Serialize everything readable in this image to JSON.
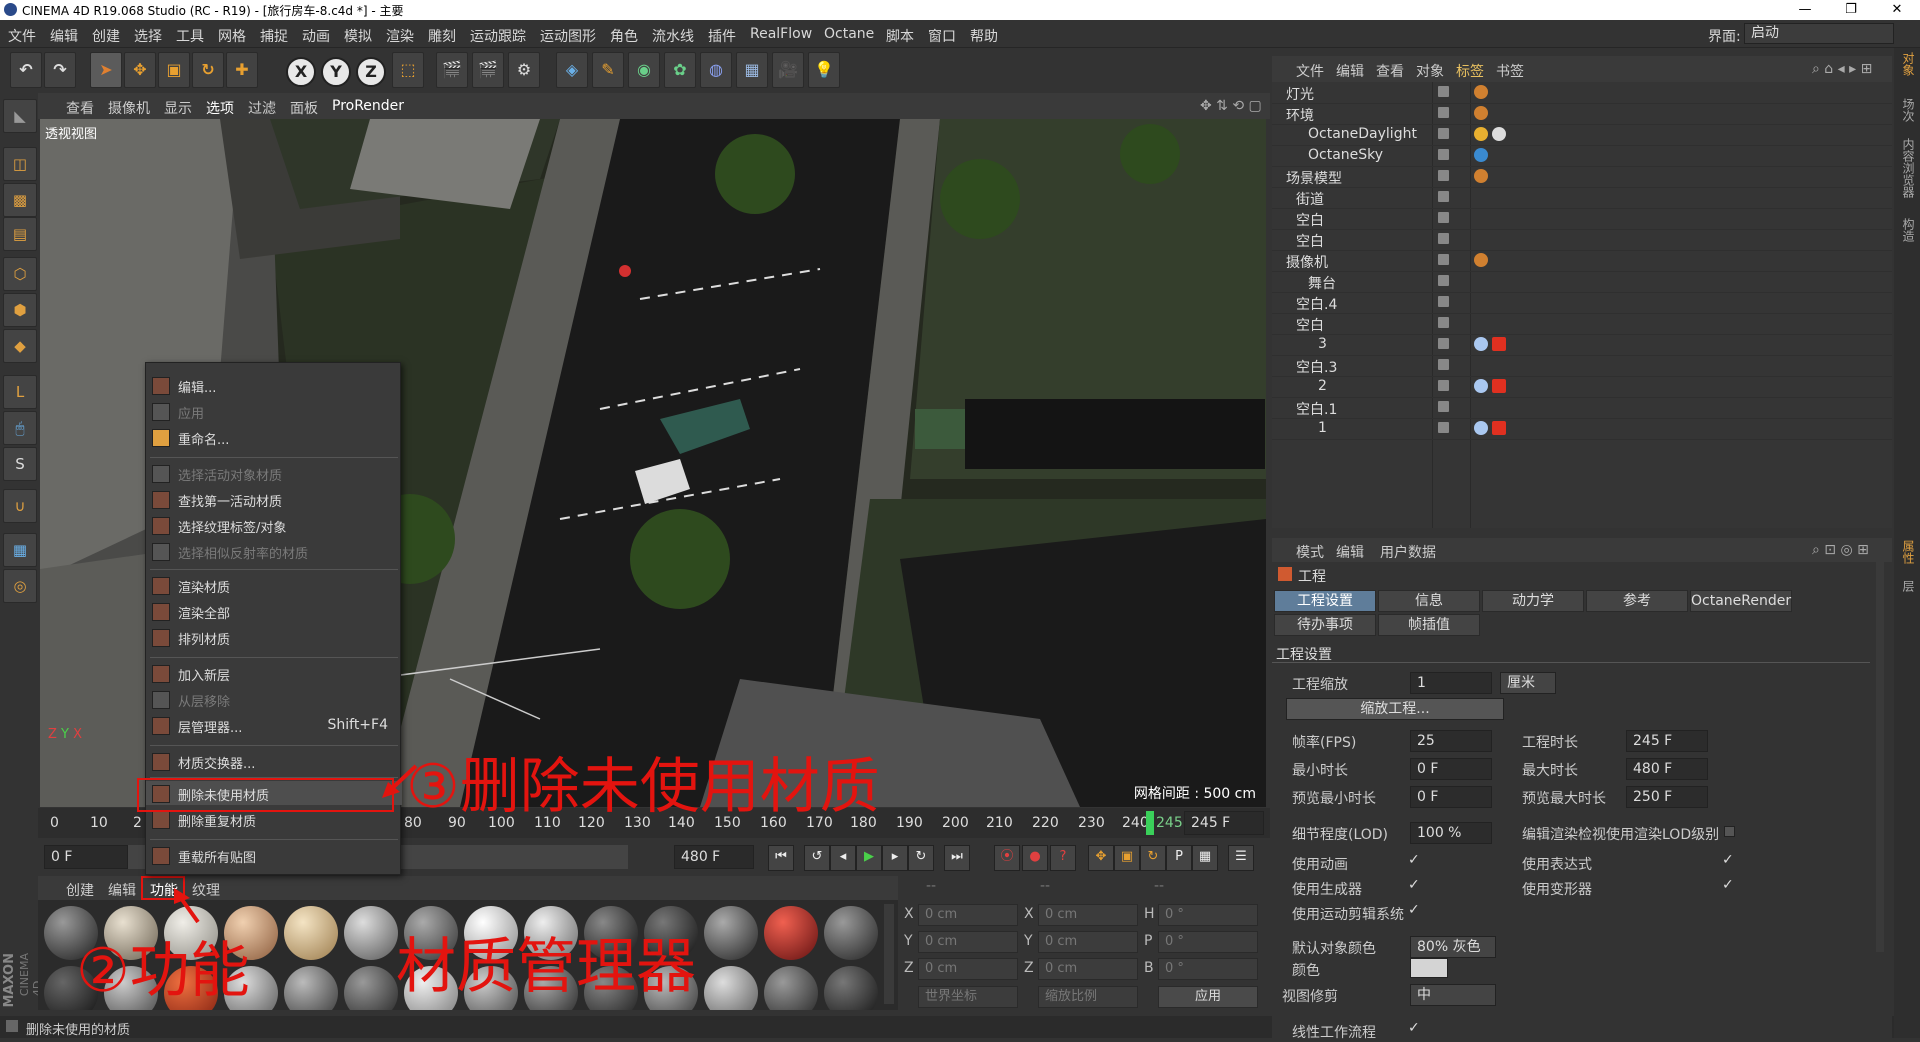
{
  "window": {
    "title": "CINEMA 4D R19.068 Studio (RC - R19) - [旅行房车-8.c4d *] - 主要"
  },
  "menu": [
    "文件",
    "编辑",
    "创建",
    "选择",
    "工具",
    "网格",
    "捕捉",
    "动画",
    "模拟",
    "渲染",
    "雕刻",
    "运动跟踪",
    "运动图形",
    "角色",
    "流水线",
    "插件",
    "RealFlow",
    "Octane",
    "脚本",
    "窗口",
    "帮助"
  ],
  "layout": {
    "label": "界面:",
    "value": "启动"
  },
  "toolbar": {
    "x": "X",
    "y": "Y",
    "z": "Z"
  },
  "viewport": {
    "menu": [
      "查看",
      "摄像机",
      "显示",
      "选项",
      "过滤",
      "面板",
      "ProRender"
    ],
    "name": "透视视图",
    "grid_info": "网格间距 : 500 cm"
  },
  "timeline": {
    "ticks": [
      "0",
      "10",
      "2",
      "80",
      "90",
      "100",
      "110",
      "120",
      "130",
      "140",
      "150",
      "160",
      "170",
      "180",
      "190",
      "200",
      "210",
      "220",
      "230",
      "240",
      "245"
    ],
    "current": "245 F",
    "start": "0 F",
    "end": "480 F"
  },
  "material_manager": {
    "menu": [
      "创建",
      "编辑",
      "功能",
      "纹理"
    ],
    "active_menu": "功能"
  },
  "coords": {
    "rows": [
      {
        "a": "X",
        "av": "0 cm",
        "b": "X",
        "bv": "0 cm",
        "c": "H",
        "cv": "0 °"
      },
      {
        "a": "Y",
        "av": "0 cm",
        "b": "Y",
        "bv": "0 cm",
        "c": "P",
        "cv": "0 °"
      },
      {
        "a": "Z",
        "av": "0 cm",
        "b": "Z",
        "bv": "0 cm",
        "c": "B",
        "cv": "0 °"
      }
    ],
    "world": "世界坐标",
    "scale": "缩放比例",
    "apply": "应用",
    "dashes": [
      "--",
      "--",
      "--"
    ]
  },
  "context_menu": {
    "items": [
      {
        "label": "编辑...",
        "disabled": false
      },
      {
        "label": "应用",
        "disabled": true
      },
      {
        "label": "重命名...",
        "disabled": false
      },
      {
        "label": "选择活动对象材质",
        "disabled": true
      },
      {
        "label": "查找第一活动材质",
        "disabled": false
      },
      {
        "label": "选择纹理标签/对象",
        "disabled": false
      },
      {
        "label": "选择相似反射率的材质",
        "disabled": true
      },
      {
        "label": "渲染材质",
        "disabled": false
      },
      {
        "label": "渲染全部",
        "disabled": false
      },
      {
        "label": "排列材质",
        "disabled": false
      },
      {
        "label": "加入新层",
        "disabled": false
      },
      {
        "label": "从层移除",
        "disabled": true
      },
      {
        "label": "层管理器...",
        "disabled": false,
        "shortcut": "Shift+F4"
      },
      {
        "label": "材质交换器...",
        "disabled": false
      },
      {
        "label": "删除未使用材质",
        "disabled": false,
        "highlight": true
      },
      {
        "label": "删除重复材质",
        "disabled": false
      },
      {
        "label": "重载所有贴图",
        "disabled": false
      }
    ]
  },
  "annotations": {
    "step3": "③删除未使用材质",
    "step2": "②功能",
    "manager": "材质管理器"
  },
  "status": "删除未使用的材质",
  "brand": {
    "maxon": "MAXON",
    "c4d": "CINEMA 4D"
  },
  "object_manager": {
    "menu": [
      "文件",
      "编辑",
      "查看",
      "对象",
      "标签",
      "书签"
    ],
    "active_menu": "标签",
    "objects": [
      {
        "name": "灯光",
        "indent": 0
      },
      {
        "name": "环境",
        "indent": 0
      },
      {
        "name": "OctaneDaylight",
        "indent": 2
      },
      {
        "name": "OctaneSky",
        "indent": 2
      },
      {
        "name": "场景模型",
        "indent": 0
      },
      {
        "name": "街道",
        "indent": 1
      },
      {
        "name": "空白",
        "indent": 1
      },
      {
        "name": "空白",
        "indent": 1
      },
      {
        "name": "摄像机",
        "indent": 0
      },
      {
        "name": "舞台",
        "indent": 2
      },
      {
        "name": "空白.4",
        "indent": 1
      },
      {
        "name": "空白",
        "indent": 1
      },
      {
        "name": "3",
        "indent": 2
      },
      {
        "name": "空白.3",
        "indent": 1
      },
      {
        "name": "2",
        "indent": 2
      },
      {
        "name": "空白.1",
        "indent": 1
      },
      {
        "name": "1",
        "indent": 2
      }
    ]
  },
  "attribute_manager": {
    "menu": [
      "模式",
      "编辑",
      "用户数据"
    ],
    "title": "工程",
    "tabs_row1": [
      "工程设置",
      "信息",
      "动力学",
      "参考",
      "OctaneRender"
    ],
    "tabs_row2": [
      "待办事项",
      "帧插值"
    ],
    "section": "工程设置",
    "scale_label": "工程缩放",
    "scale_value": "1",
    "scale_unit": "厘米",
    "scale_button": "缩放工程...",
    "fps_label": "帧率(FPS)",
    "fps": "25",
    "duration_label": "工程时长",
    "duration": "245 F",
    "min_label": "最小时长",
    "min": "0 F",
    "max_label": "最大时长",
    "max": "480 F",
    "pmin_label": "预览最小时长",
    "pmin": "0 F",
    "pmax_label": "预览最大时长",
    "pmax": "250 F",
    "lod_label": "细节程度(LOD)",
    "lod": "100 %",
    "lod_render_label": "编辑渲染检视使用渲染LOD级别",
    "use_anim": "使用动画",
    "use_expr": "使用表达式",
    "use_gen": "使用生成器",
    "use_deform": "使用变形器",
    "use_motion": "使用运动剪辑系统",
    "default_color_label": "默认对象颜色",
    "default_color": "80% 灰色",
    "color_label": "颜色",
    "view_clip_label": "视图修剪",
    "view_clip": "中",
    "linear_label": "线性工作流程",
    "check": "✓"
  },
  "right_tabs": [
    "对象",
    "场次",
    "内容浏览器",
    "构造",
    "属性",
    "层"
  ]
}
